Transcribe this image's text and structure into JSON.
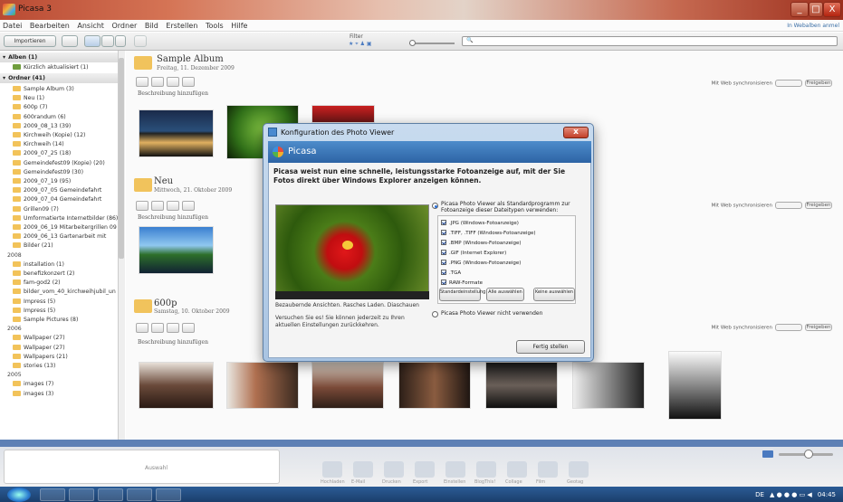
{
  "window": {
    "title": "Picasa 3",
    "min": "_",
    "max": "□",
    "close": "X"
  },
  "menu": {
    "items": [
      "Datei",
      "Bearbeiten",
      "Ansicht",
      "Ordner",
      "Bild",
      "Erstellen",
      "Tools",
      "Hilfe"
    ],
    "help_link": "In Webalben anmel"
  },
  "toolbar": {
    "import_label": "Importieren",
    "filter_label": "Filter",
    "search_placeholder": ""
  },
  "sidebar": {
    "albums_header": "Alben (1)",
    "recent": "Kürzlich aktualisiert (1)",
    "folders_header": "Ordner (41)",
    "folders": [
      "Sample Album (3)",
      "Neu (1)",
      "600p (7)",
      "600randum (6)",
      "2009_08_13 (39)",
      "Kirchweih (Kopie) (12)",
      "Kirchweih (14)",
      "2009_07_25 (18)",
      "Gemeindefest09 (Kopie) (20)",
      "Gemeindefest09 (30)",
      "2009_07_19 (95)",
      "2009_07_05 Gemeindefahrt",
      "2009_07_04 Gemeindefahrt",
      "Grillen09 (7)",
      "Umformatierte Internetbilder (86)",
      "2009_06_19 Mitarbeitergrillen 09",
      "2009_06_13 Gartenarbeit mit",
      "Bilder (21)"
    ],
    "year1": "2008",
    "folders2008": [
      "installation (1)",
      "benefizkonzert (2)",
      "fam-god2 (2)",
      "bilder_vom_40_kirchweihjubil_un",
      "Impress (5)",
      "Impress (5)",
      "Sample Pictures (8)"
    ],
    "year2": "2006",
    "folders2006": [
      "Wallpaper (27)",
      "Wallpaper (27)",
      "Wallpapers (21)",
      "stories (13)"
    ],
    "year3": "2005",
    "folders2005": [
      "images (7)",
      "images (3)"
    ]
  },
  "albums": [
    {
      "title": "Sample Album",
      "date": "Freitag, 11. Dezember 2009",
      "desc": "Beschreibung hinzufügen"
    },
    {
      "title": "Neu",
      "date": "Mittwoch, 21. Oktober 2009",
      "desc": "Beschreibung hinzufügen"
    },
    {
      "title": "600p",
      "date": "Samstag, 10. Oktober 2009",
      "desc": "Beschreibung hinzufügen"
    }
  ],
  "sync": {
    "label": "Mit Web synchronisieren",
    "share": "Freigeben"
  },
  "dialog": {
    "title": "Konfiguration des Photo Viewer",
    "brand": "Picasa",
    "intro": "Picasa weist nun eine schnelle, leistungsstarke Fotoanzeige auf, mit der Sie Fotos direkt über Windows Explorer anzeigen können.",
    "caption1": "Bezaubernde Ansichten. Rasches Laden. Diaschauen",
    "caption2": "Versuchen Sie es! Sie können jederzeit zu Ihren aktuellen Einstellungen zurückkehren.",
    "option1": "Picasa Photo Viewer als Standardprogramm zur Fotoanzeige dieser Dateitypen verwenden:",
    "filetypes": [
      ".JPG (Windows-Fotoanzeige)",
      ".TIFF, .TIFF (Windows-Fotoanzeige)",
      ".BMP (Windows-Fotoanzeige)",
      ".GIF (Internet Explorer)",
      ".PNG (Windows-Fotoanzeige)",
      ".TGA",
      "RAW-Formate"
    ],
    "btn_default": "Standardeinstellung",
    "btn_all": "Alle auswählen",
    "btn_none": "Keine auswählen",
    "option2": "Picasa Photo Viewer nicht verwenden",
    "finish": "Fertig stellen"
  },
  "bottom": {
    "selection": "Auswahl",
    "actions": [
      "Hochladen",
      "E-Mail",
      "Drucken",
      "Export",
      "Einstellen",
      "BlogThis!",
      "Collage",
      "Film",
      "Geotag"
    ]
  },
  "taskbar": {
    "lang": "DE",
    "time": "04:45"
  }
}
